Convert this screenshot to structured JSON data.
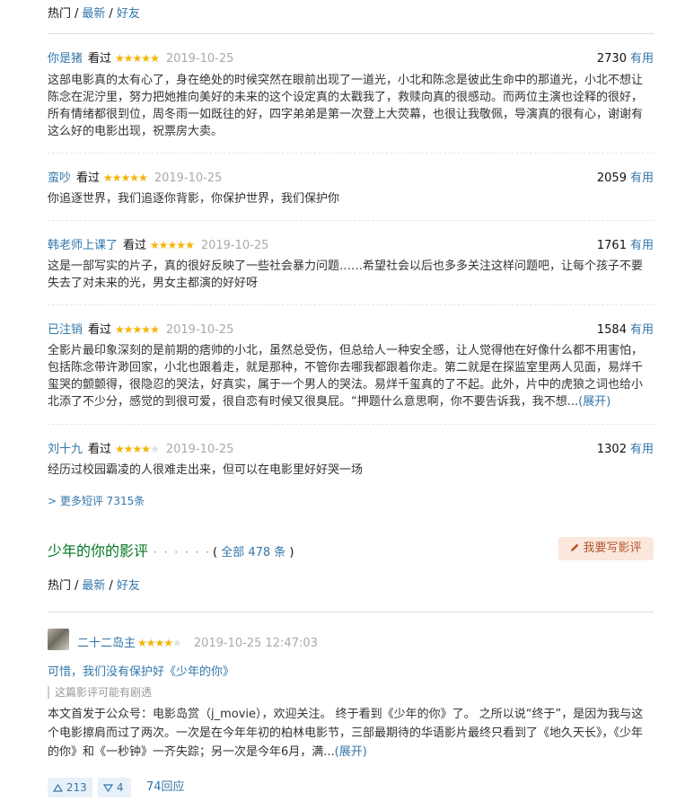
{
  "top_tabs": {
    "hot": "热门",
    "latest": "最新",
    "friends": "好友",
    "sep": "/"
  },
  "comments": [
    {
      "user": "你是猪",
      "watched": "看过",
      "rating": 5,
      "date": "2019-10-25",
      "votes": "2730",
      "useful": "有用",
      "text": "这部电影真的太有心了，身在绝处的时候突然在眼前出现了一道光，小北和陈念是彼此生命中的那道光，小北不想让陈念在泥泞里，努力把她推向美好的未来的这个设定真的太戳我了，救赎向真的很感动。而两位主演也诠释的很好，所有情绪都很到位，周冬雨一如既往的好，四字弟弟是第一次登上大荧幕，也很让我敬佩，导演真的很有心，谢谢有这么好的电影出现，祝票房大卖。"
    },
    {
      "user": "蛮吵",
      "watched": "看过",
      "rating": 5,
      "date": "2019-10-25",
      "votes": "2059",
      "useful": "有用",
      "text": "你追逐世界，我们追逐你背影，你保护世界，我们保护你"
    },
    {
      "user": "韩老师上课了",
      "watched": "看过",
      "rating": 5,
      "date": "2019-10-25",
      "votes": "1761",
      "useful": "有用",
      "text": "这是一部写实的片子，真的很好反映了一些社会暴力问题……希望社会以后也多多关注这样问题吧，让每个孩子不要失去了对未来的光，男女主都演的好好呀"
    },
    {
      "user": "已注销",
      "watched": "看过",
      "rating": 5,
      "date": "2019-10-25",
      "votes": "1584",
      "useful": "有用",
      "text": "全影片最印象深刻的是前期的痞帅的小北，虽然总受伤，但总给人一种安全感，让人觉得他在好像什么都不用害怕，包括陈念带许渺回家，小北也跟着走，就是那种，不管你去哪我都跟着你走。第二就是在探监室里两人见面，易烊千玺哭的颤颤得，很隐忍的哭法，好真实，属于一个男人的哭法。易烊千玺真的了不起。此外，片中的虎狼之词也给小北添了不少分，感觉的到很可爱，很自恋有时候又很臭屁。“押题什么意思啊，你不要告诉我，我不想...",
      "expand": "(展开)"
    },
    {
      "user": "刘十九",
      "watched": "看过",
      "rating": 4,
      "date": "2019-10-25",
      "votes": "1302",
      "useful": "有用",
      "text": "经历过校园霸凌的人很难走出来，但可以在电影里好好哭一场"
    }
  ],
  "more_short": "> 更多短评 7315条",
  "reviews_section": {
    "title": "少年的你的影评",
    "dots": "· · · · · ·",
    "count_prefix": "( ",
    "count_label": "全部 478 条",
    "count_suffix": " )",
    "write_button": "我要写影评",
    "tabs": {
      "hot": "热门",
      "latest": "最新",
      "friends": "好友",
      "sep": "/"
    }
  },
  "review": {
    "user": "二十二岛主",
    "rating": 4,
    "datetime": "2019-10-25 12:47:03",
    "title": "可惜，我们没有保护好《少年的你》",
    "spoiler": "这篇影评可能有剧透",
    "text": "本文首发于公众号：电影岛赏（j_movie），欢迎关注。 终于看到《少年的你》了。 之所以说“终于”，是因为我与这个电影擦肩而过了两次。一次是在今年年初的柏林电影节，三部最期待的华语影片最终只看到了《地久天长》，《少年的你》和《一秒钟》一齐失踪；另一次是今年6月，满...",
    "expand": "(展开)",
    "up": "213",
    "down": "4",
    "replies": "74回应"
  },
  "colors": {
    "link": "#3377aa",
    "star": "#f7b500",
    "section_title": "#007722",
    "write_btn_bg": "#fbe7dc"
  },
  "icons": {
    "star": "star-icon",
    "pencil": "pencil-icon",
    "up": "triangle-up-icon",
    "down": "triangle-down-icon"
  }
}
